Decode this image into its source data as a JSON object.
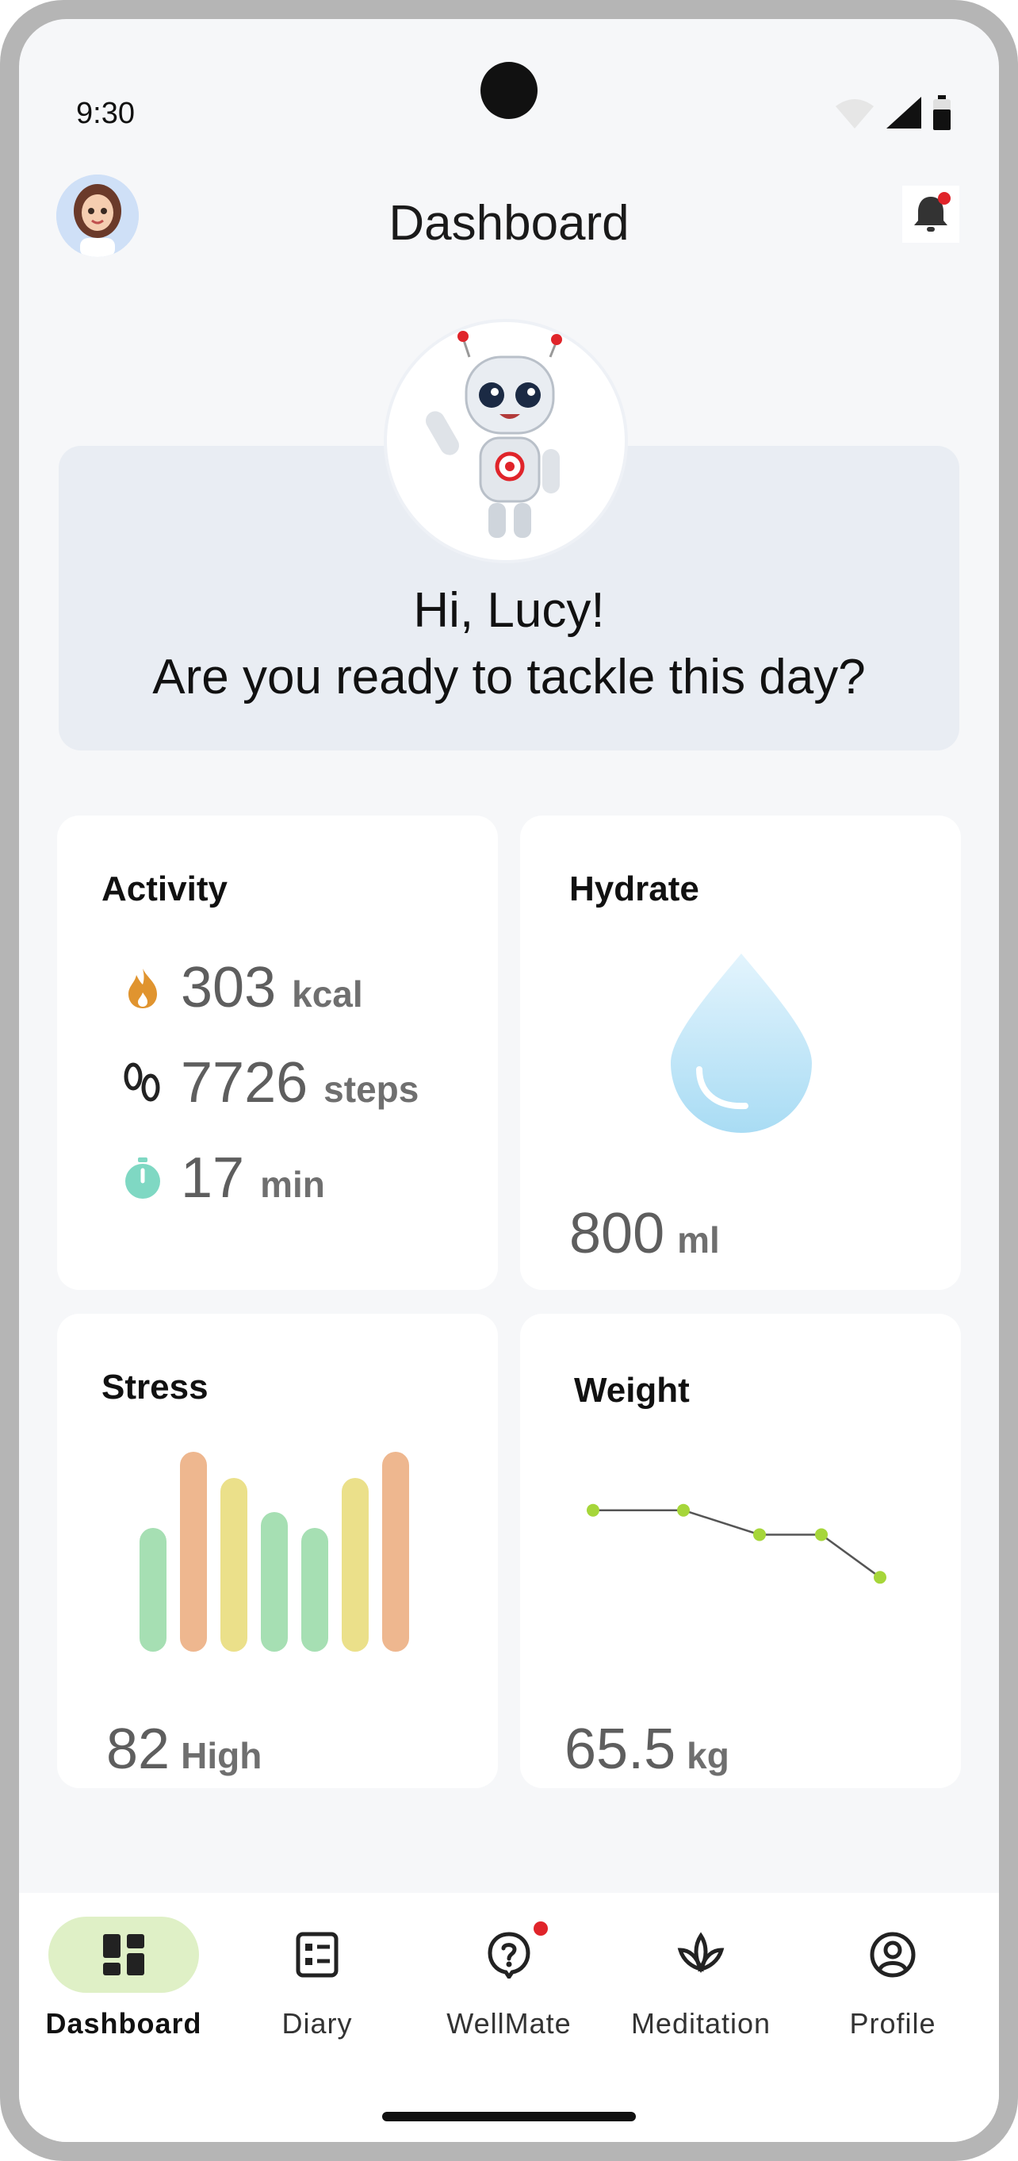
{
  "status_bar": {
    "time": "9:30"
  },
  "header": {
    "title": "Dashboard"
  },
  "greeting": {
    "line1": "Hi, Lucy!",
    "line2": "Are you ready to tackle this day?"
  },
  "cards": {
    "activity": {
      "title": "Activity",
      "calories": {
        "value": "303",
        "unit": "kcal",
        "icon": "flame-icon"
      },
      "steps": {
        "value": "7726",
        "unit": "steps",
        "icon": "footprints-icon"
      },
      "duration": {
        "value": "17",
        "unit": "min",
        "icon": "stopwatch-icon"
      }
    },
    "hydrate": {
      "title": "Hydrate",
      "value": "800",
      "unit": "ml",
      "icon": "water-drop-icon"
    },
    "stress": {
      "title": "Stress",
      "value": "82",
      "unit": "High",
      "bars": [
        {
          "level": 0.62,
          "color": "#a6dfb3"
        },
        {
          "level": 1.0,
          "color": "#eeb78f"
        },
        {
          "level": 0.87,
          "color": "#ebe08a"
        },
        {
          "level": 0.7,
          "color": "#a6dfb3"
        },
        {
          "level": 0.62,
          "color": "#a6dfb3"
        },
        {
          "level": 0.87,
          "color": "#ebe08a"
        },
        {
          "level": 1.0,
          "color": "#eeb78f"
        }
      ]
    },
    "weight": {
      "title": "Weight",
      "value": "65.5",
      "unit": "kg",
      "trend": [
        66.6,
        66.6,
        66.2,
        66.2,
        65.5
      ]
    }
  },
  "nav": {
    "items": [
      {
        "label": "Dashboard",
        "icon": "dashboard-icon",
        "active": true
      },
      {
        "label": "Diary",
        "icon": "diary-icon"
      },
      {
        "label": "WellMate",
        "icon": "chat-help-icon",
        "badge": true
      },
      {
        "label": "Meditation",
        "icon": "lotus-icon"
      },
      {
        "label": "Profile",
        "icon": "profile-icon"
      }
    ]
  },
  "colors": {
    "accent": "#dff0c6",
    "greeting_bg": "#e9edf3",
    "badge": "#e0242a"
  }
}
